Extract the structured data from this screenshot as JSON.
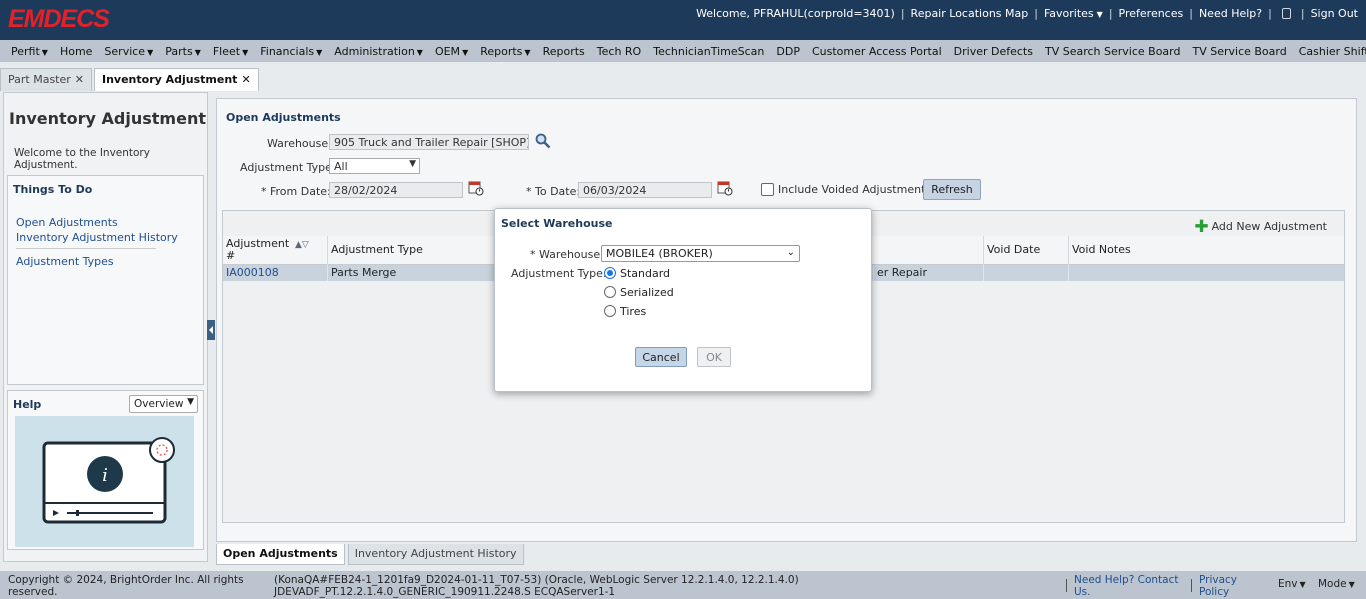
{
  "header": {
    "logo": "EMDECS",
    "welcome": "Welcome, PFRAHUL(corproId=3401)",
    "repair_map": "Repair Locations Map",
    "favorites": "Favorites",
    "preferences": "Preferences",
    "need_help": "Need Help?",
    "sign_out": "Sign Out"
  },
  "menu": [
    {
      "label": "Perfit",
      "dropdown": true
    },
    {
      "label": "Home",
      "dropdown": false
    },
    {
      "label": "Service",
      "dropdown": true
    },
    {
      "label": "Parts",
      "dropdown": true
    },
    {
      "label": "Fleet",
      "dropdown": true
    },
    {
      "label": "Financials",
      "dropdown": true
    },
    {
      "label": "Administration",
      "dropdown": true
    },
    {
      "label": "OEM",
      "dropdown": true
    },
    {
      "label": "Reports",
      "dropdown": true
    },
    {
      "label": "Reports",
      "dropdown": false
    },
    {
      "label": "Tech RO",
      "dropdown": false
    },
    {
      "label": "TechnicianTimeScan",
      "dropdown": false
    },
    {
      "label": "DDP",
      "dropdown": false
    },
    {
      "label": "Customer Access Portal",
      "dropdown": false
    },
    {
      "label": "Driver Defects",
      "dropdown": false
    },
    {
      "label": "TV Search Service Board",
      "dropdown": false
    },
    {
      "label": "TV Service Board",
      "dropdown": false
    },
    {
      "label": "Cashier Shift",
      "dropdown": false
    }
  ],
  "tabs": [
    {
      "label": "Part Master",
      "active": false
    },
    {
      "label": "Inventory Adjustment",
      "active": true
    }
  ],
  "left": {
    "title": "Inventory Adjustment",
    "welcome": "Welcome to the Inventory Adjustment.",
    "things_title": "Things To Do",
    "links": [
      "Open Adjustments",
      "Inventory Adjustment History",
      "Adjustment Types"
    ],
    "help_title": "Help",
    "help_select": "Overview"
  },
  "main": {
    "title": "Open Adjustments",
    "warehouse_label": "Warehouse:",
    "warehouse_value": "905 Truck and Trailer Repair [SHOP]",
    "adj_type_label": "Adjustment Type:",
    "adj_type_value": "All",
    "from_label": "* From Date:",
    "from_value": "28/02/2024",
    "to_label": "* To Date:",
    "to_value": "06/03/2024",
    "include_voided": "Include Voided Adjustments",
    "refresh": "Refresh",
    "add_new": "Add New Adjustment",
    "columns": [
      "Adjustment #",
      "Adjustment Type",
      "Void Date",
      "Void Notes"
    ],
    "row": {
      "id": "IA000108",
      "type": "Parts Merge",
      "partial": "er Repair"
    }
  },
  "bottom_tabs": [
    {
      "label": "Open Adjustments",
      "active": true
    },
    {
      "label": "Inventory Adjustment History",
      "active": false
    }
  ],
  "footer": {
    "copyright": "Copyright © 2024, BrightOrder Inc. All rights reserved.",
    "info": "(KonaQA#FEB24-1_1201fa9_D2024-01-11_T07-53) (Oracle, WebLogic Server 12.2.1.4.0, 12.2.1.4.0) JDEVADF_PT.12.2.1.4.0_GENERIC_190911.2248.S ECQAServer1-1",
    "need_help": "Need Help? Contact Us.",
    "privacy": "Privacy Policy",
    "env": "Env",
    "mode": "Mode"
  },
  "dialog": {
    "title": "Select Warehouse",
    "warehouse_label": "* Warehouse:",
    "warehouse_value": "MOBILE4 (BROKER)",
    "type_label": "Adjustment Type:",
    "options": [
      "Standard",
      "Serialized",
      "Tires"
    ],
    "selected": "Standard",
    "cancel": "Cancel",
    "ok": "OK"
  },
  "colors": {
    "header_bg": "#1e3a5a",
    "logo": "#e42128",
    "link": "#1f4e8f",
    "selected_row": "#c9d3de",
    "add_icon": "#2a9d36"
  }
}
